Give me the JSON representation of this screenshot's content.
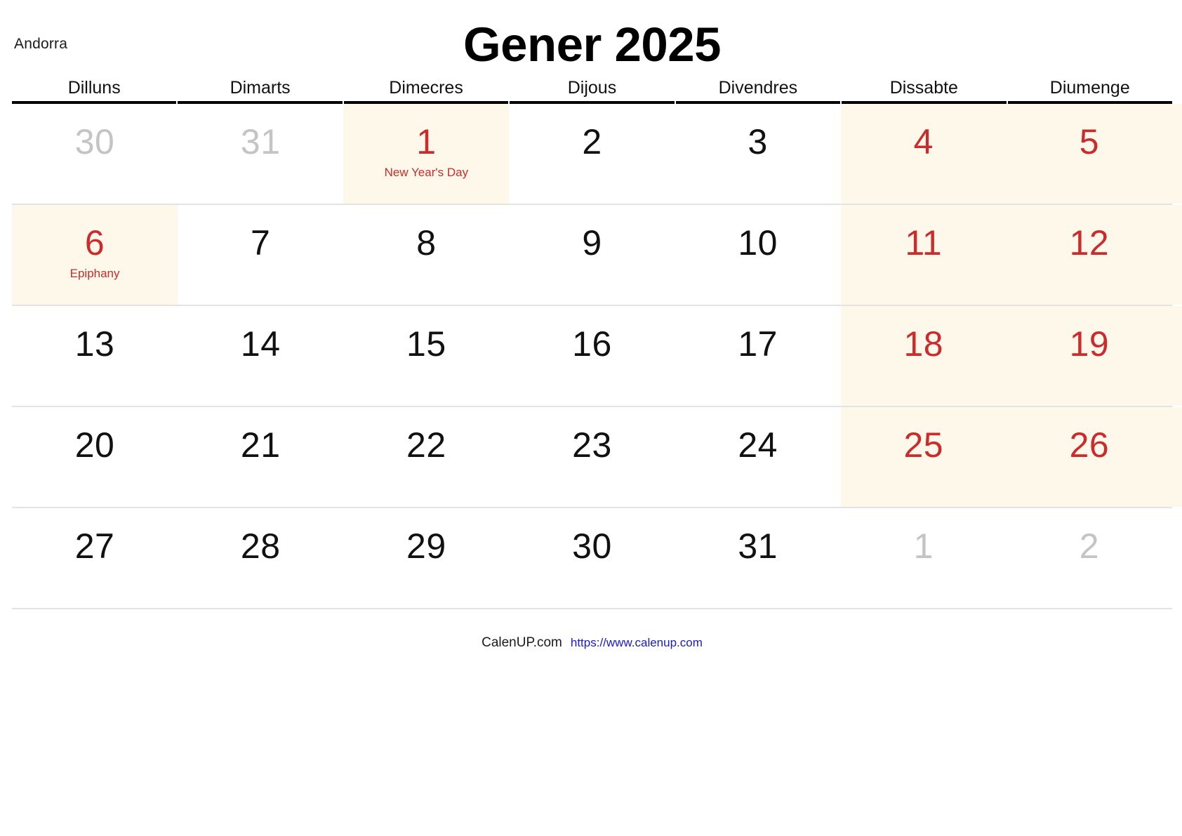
{
  "header": {
    "country": "Andorra",
    "title": "Gener 2025"
  },
  "weekdays": [
    "Dilluns",
    "Dimarts",
    "Dimecres",
    "Dijous",
    "Divendres",
    "Dissabte",
    "Diumenge"
  ],
  "colors": {
    "weekend_background": "#fdf8ea",
    "holiday_red": "#cb2b2b",
    "muted_gray": "#c4c4c4",
    "link_blue": "#1919d0",
    "header_rule": "#000000",
    "row_rule": "#e3e3e3"
  },
  "weeks": [
    [
      {
        "num": "30",
        "style": "muted",
        "shaded": false,
        "holiday": ""
      },
      {
        "num": "31",
        "style": "muted",
        "shaded": false,
        "holiday": ""
      },
      {
        "num": "1",
        "style": "red",
        "shaded": true,
        "holiday": "New Year's Day"
      },
      {
        "num": "2",
        "style": "normal",
        "shaded": false,
        "holiday": ""
      },
      {
        "num": "3",
        "style": "normal",
        "shaded": false,
        "holiday": ""
      },
      {
        "num": "4",
        "style": "red",
        "shaded": true,
        "holiday": ""
      },
      {
        "num": "5",
        "style": "red",
        "shaded": true,
        "holiday": ""
      }
    ],
    [
      {
        "num": "6",
        "style": "red",
        "shaded": true,
        "holiday": "Epiphany"
      },
      {
        "num": "7",
        "style": "normal",
        "shaded": false,
        "holiday": ""
      },
      {
        "num": "8",
        "style": "normal",
        "shaded": false,
        "holiday": ""
      },
      {
        "num": "9",
        "style": "normal",
        "shaded": false,
        "holiday": ""
      },
      {
        "num": "10",
        "style": "normal",
        "shaded": false,
        "holiday": ""
      },
      {
        "num": "11",
        "style": "red",
        "shaded": true,
        "holiday": ""
      },
      {
        "num": "12",
        "style": "red",
        "shaded": true,
        "holiday": ""
      }
    ],
    [
      {
        "num": "13",
        "style": "normal",
        "shaded": false,
        "holiday": ""
      },
      {
        "num": "14",
        "style": "normal",
        "shaded": false,
        "holiday": ""
      },
      {
        "num": "15",
        "style": "normal",
        "shaded": false,
        "holiday": ""
      },
      {
        "num": "16",
        "style": "normal",
        "shaded": false,
        "holiday": ""
      },
      {
        "num": "17",
        "style": "normal",
        "shaded": false,
        "holiday": ""
      },
      {
        "num": "18",
        "style": "red",
        "shaded": true,
        "holiday": ""
      },
      {
        "num": "19",
        "style": "red",
        "shaded": true,
        "holiday": ""
      }
    ],
    [
      {
        "num": "20",
        "style": "normal",
        "shaded": false,
        "holiday": ""
      },
      {
        "num": "21",
        "style": "normal",
        "shaded": false,
        "holiday": ""
      },
      {
        "num": "22",
        "style": "normal",
        "shaded": false,
        "holiday": ""
      },
      {
        "num": "23",
        "style": "normal",
        "shaded": false,
        "holiday": ""
      },
      {
        "num": "24",
        "style": "normal",
        "shaded": false,
        "holiday": ""
      },
      {
        "num": "25",
        "style": "red",
        "shaded": true,
        "holiday": ""
      },
      {
        "num": "26",
        "style": "red",
        "shaded": true,
        "holiday": ""
      }
    ],
    [
      {
        "num": "27",
        "style": "normal",
        "shaded": false,
        "holiday": ""
      },
      {
        "num": "28",
        "style": "normal",
        "shaded": false,
        "holiday": ""
      },
      {
        "num": "29",
        "style": "normal",
        "shaded": false,
        "holiday": ""
      },
      {
        "num": "30",
        "style": "normal",
        "shaded": false,
        "holiday": ""
      },
      {
        "num": "31",
        "style": "normal",
        "shaded": false,
        "holiday": ""
      },
      {
        "num": "1",
        "style": "muted",
        "shaded": false,
        "holiday": ""
      },
      {
        "num": "2",
        "style": "muted",
        "shaded": false,
        "holiday": ""
      }
    ]
  ],
  "footer": {
    "brand": "CalenUP.com",
    "url": "https://www.calenup.com"
  }
}
